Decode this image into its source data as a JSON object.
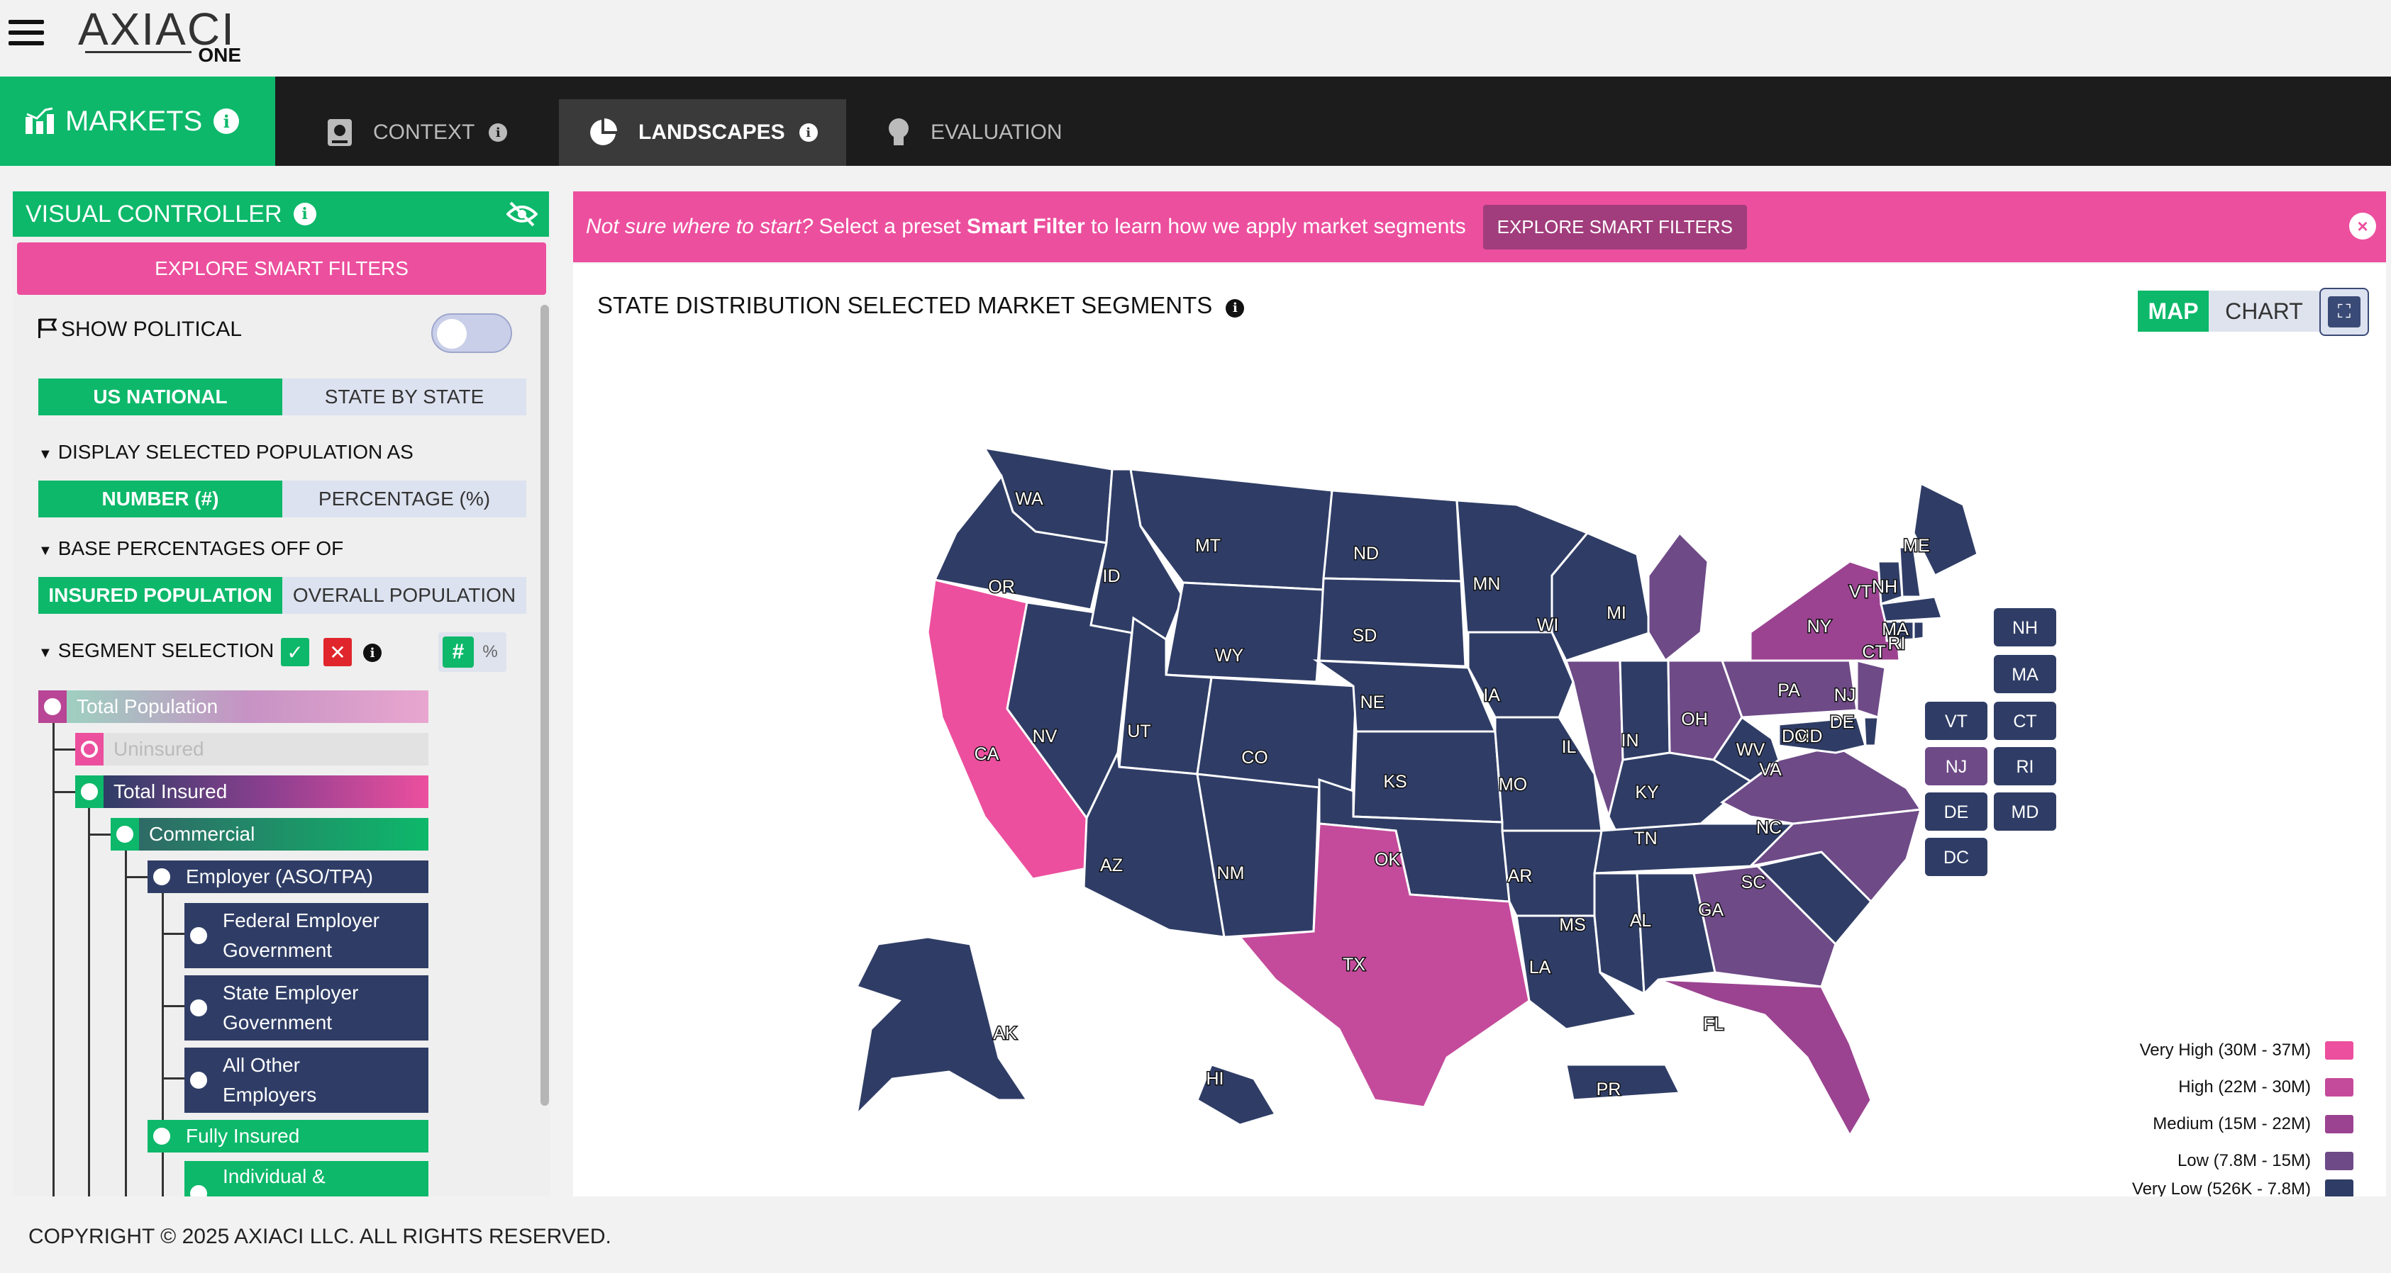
{
  "app": {
    "logo_text": "AXIACI",
    "logo_sub": "ONE"
  },
  "nav": {
    "markets_label": "MARKETS",
    "tabs": [
      {
        "label": "CONTEXT",
        "icon": "book-icon"
      },
      {
        "label": "LANDSCAPES",
        "icon": "pie-chart-icon"
      },
      {
        "label": "EVALUATION",
        "icon": "lightbulb-icon"
      }
    ]
  },
  "sidebar": {
    "title": "VISUAL CONTROLLER",
    "explore_label": "EXPLORE SMART FILTERS",
    "show_political": "SHOW POLITICAL",
    "scope": [
      "US NATIONAL",
      "STATE BY STATE"
    ],
    "display_heading": "DISPLAY SELECTED POPULATION AS",
    "display_opts": [
      "NUMBER (#)",
      "PERCENTAGE (%)"
    ],
    "base_heading": "BASE PERCENTAGES OFF OF",
    "base_opts": [
      "INSURED POPULATION",
      "OVERALL POPULATION"
    ],
    "segment_heading": "SEGMENT SELECTION",
    "hash_label": "#",
    "pct_label": "%",
    "tree": [
      {
        "label": "Total Population"
      },
      {
        "label": "Uninsured"
      },
      {
        "label": "Total Insured"
      },
      {
        "label": "Commercial"
      },
      {
        "label": "Employer (ASO/TPA)"
      },
      {
        "label": "Federal Employer Government"
      },
      {
        "label": "State Employer Government"
      },
      {
        "label": "All Other Employers"
      },
      {
        "label": "Fully Insured"
      },
      {
        "label": "Individual &"
      }
    ]
  },
  "banner": {
    "lead": "Not sure where to start?",
    "text_a": " Select a preset ",
    "bold": "Smart Filter",
    "text_b": " to learn how we apply market segments",
    "button": "EXPLORE SMART FILTERS",
    "close": "×"
  },
  "panel": {
    "title": "STATE DISTRIBUTION SELECTED MARKET SEGMENTS",
    "view_map": "MAP",
    "view_chart": "CHART"
  },
  "map": {
    "state_labels": [
      "WA",
      "OR",
      "CA",
      "NV",
      "ID",
      "MT",
      "WY",
      "UT",
      "AZ",
      "NM",
      "CO",
      "ND",
      "SD",
      "NE",
      "KS",
      "OK",
      "TX",
      "MN",
      "IA",
      "MO",
      "AR",
      "LA",
      "WI",
      "IL",
      "MI",
      "IN",
      "OH",
      "KY",
      "TN",
      "MS",
      "AL",
      "GA",
      "FL",
      "SC",
      "NC",
      "VA",
      "WV",
      "PA",
      "NY",
      "ME",
      "VT",
      "NH",
      "MA",
      "CT",
      "RI",
      "NJ",
      "DE",
      "MD",
      "DC",
      "AK",
      "HI",
      "PR"
    ],
    "small_state_boxes": [
      "NH",
      "MA",
      "VT",
      "CT",
      "NJ",
      "RI",
      "DE",
      "MD",
      "DC"
    ],
    "highlight": {
      "CA": "Very High",
      "TX": "High",
      "FL": "Medium",
      "NY": "Medium",
      "PA": "Low",
      "IL": "Low",
      "OH": "Low",
      "GA": "Low",
      "NC": "Low",
      "MI": "Low",
      "NJ": "Low",
      "VA": "Low"
    }
  },
  "legend": [
    {
      "label": "Very High (30M - 37M)",
      "color": "#ec4f9e"
    },
    {
      "label": "High (22M - 30M)",
      "color": "#c44b9b"
    },
    {
      "label": "Medium (15M - 22M)",
      "color": "#9b4391"
    },
    {
      "label": "Low (7.8M - 15M)",
      "color": "#6e4a87"
    },
    {
      "label": "Very Low (526K - 7.8M)",
      "color": "#2f3d66"
    }
  ],
  "footer": {
    "copyright": "COPYRIGHT © 2025 AXIACI LLC. ALL RIGHTS RESERVED."
  },
  "colors": {
    "green": "#0db86a",
    "pink": "#ec4f9e",
    "navy": "#2f3d66",
    "nav_bg": "#1c1c1c"
  }
}
